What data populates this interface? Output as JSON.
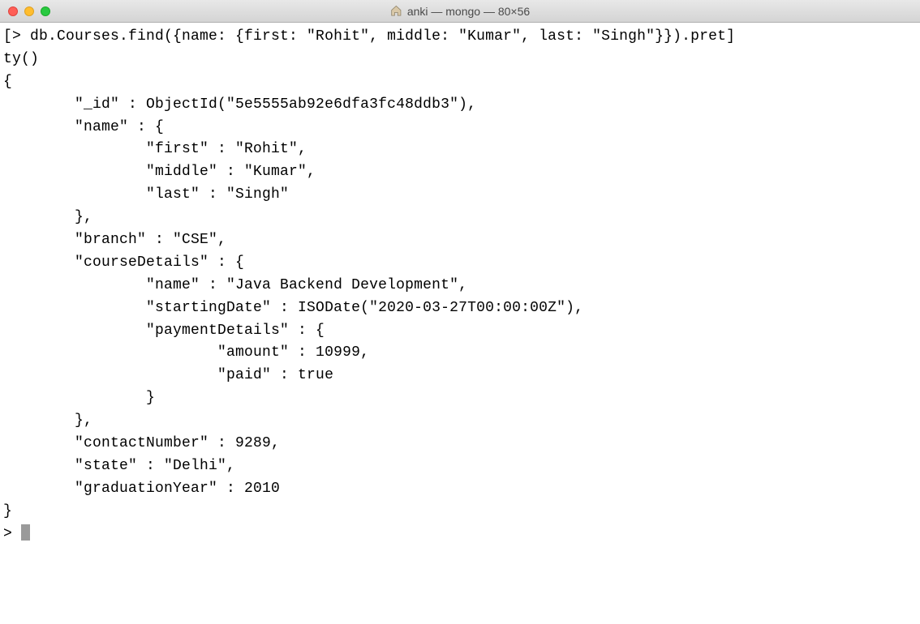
{
  "window": {
    "title": "anki — mongo — 80×56"
  },
  "terminal": {
    "lines": [
      "[> db.Courses.find({name: {first: \"Rohit\", middle: \"Kumar\", last: \"Singh\"}}).pret]",
      "ty()",
      "{",
      "        \"_id\" : ObjectId(\"5e5555ab92e6dfa3fc48ddb3\"),",
      "        \"name\" : {",
      "                \"first\" : \"Rohit\",",
      "                \"middle\" : \"Kumar\",",
      "                \"last\" : \"Singh\"",
      "        },",
      "        \"branch\" : \"CSE\",",
      "        \"courseDetails\" : {",
      "                \"name\" : \"Java Backend Development\",",
      "                \"startingDate\" : ISODate(\"2020-03-27T00:00:00Z\"),",
      "                \"paymentDetails\" : {",
      "                        \"amount\" : 10999,",
      "                        \"paid\" : true",
      "                }",
      "        },",
      "        \"contactNumber\" : 9289,",
      "        \"state\" : \"Delhi\",",
      "        \"graduationYear\" : 2010",
      "}",
      "> "
    ]
  }
}
